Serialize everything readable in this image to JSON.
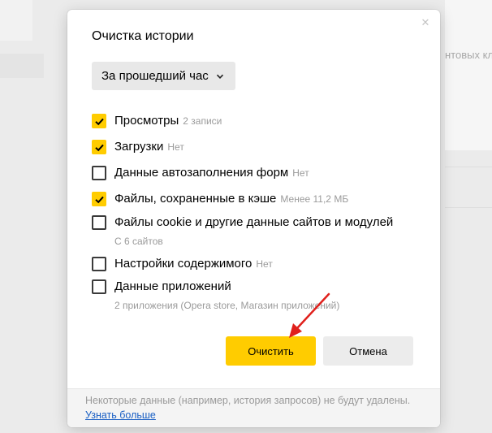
{
  "background": {
    "partial_text": "нтовых кл"
  },
  "dialog": {
    "title": "Очистка истории",
    "close_icon": "close-icon",
    "period": {
      "selected": "За прошедший час",
      "icon": "chevron-down-icon"
    },
    "options": [
      {
        "label": "Просмотры",
        "meta": "2 записи",
        "checked": true
      },
      {
        "label": "Загрузки",
        "meta": "Нет",
        "checked": true
      },
      {
        "label": "Данные автозаполнения форм",
        "meta": "Нет",
        "checked": false
      },
      {
        "label": "Файлы, сохраненные в кэше",
        "meta": "Менее 11,2 МБ",
        "checked": true
      },
      {
        "label": "Файлы cookie и другие данные сайтов и модулей",
        "meta": "",
        "sub": "С 6 сайтов",
        "checked": false
      },
      {
        "label": "Настройки содержимого",
        "meta": "Нет",
        "checked": false
      },
      {
        "label": "Данные приложений",
        "meta": "",
        "sub": "2 приложения (Opera store, Магазин приложений)",
        "checked": false
      }
    ],
    "buttons": {
      "clear": "Очистить",
      "cancel": "Отмена"
    },
    "footer": {
      "note": "Некоторые данные (например, история запросов) не будут удалены.",
      "link": "Узнать больше"
    }
  },
  "colors": {
    "accent": "#ffcc00",
    "link": "#1a5fc4",
    "annotation_arrow": "#e0201c"
  }
}
